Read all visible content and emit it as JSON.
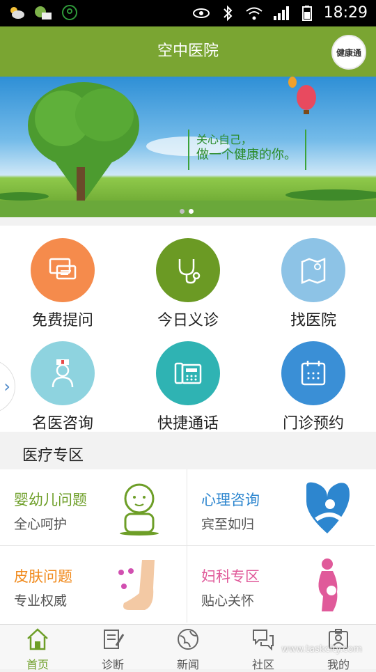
{
  "status_bar": {
    "time": "18:29",
    "icons": [
      "weather-icon",
      "message-icon",
      "app-icon",
      "eye-icon",
      "bluetooth-icon",
      "wifi-icon",
      "signal-icon",
      "battery-icon"
    ]
  },
  "app_bar": {
    "title": "空中医院",
    "badge": "健康通",
    "color": "#7aa532"
  },
  "banner": {
    "line1": "关心自己，",
    "line2": "做一个健康的你。",
    "page_count": 2,
    "active_page": 2
  },
  "grid": {
    "items": [
      {
        "label": "免费提问",
        "color": "#f58b4c",
        "icon": "chat-icon"
      },
      {
        "label": "今日义诊",
        "color": "#6b9a24",
        "icon": "stethoscope-icon"
      },
      {
        "label": "找医院",
        "color": "#8dc3e6",
        "icon": "map-icon"
      },
      {
        "label": "名医咨询",
        "color": "#8ed3df",
        "icon": "doctor-icon"
      },
      {
        "label": "快捷通话",
        "color": "#2fb3b3",
        "icon": "phone-icon"
      },
      {
        "label": "门诊预约",
        "color": "#3a8fd6",
        "icon": "calendar-icon"
      }
    ]
  },
  "section": {
    "title": "医疗专区"
  },
  "cards": [
    {
      "title": "婴幼儿问题",
      "subtitle": "全心呵护",
      "color": "#6d9e27",
      "icon": "baby-icon"
    },
    {
      "title": "心理咨询",
      "subtitle": "宾至如归",
      "color": "#2d86cf",
      "icon": "heart-person-icon"
    },
    {
      "title": "皮肤问题",
      "subtitle": "专业权威",
      "color": "#f08a1c",
      "icon": "foot-icon"
    },
    {
      "title": "妇科专区",
      "subtitle": "贴心关怀",
      "color": "#e05a9a",
      "icon": "pregnant-icon"
    }
  ],
  "tabs": [
    {
      "label": "首页",
      "icon": "home-icon",
      "active": true
    },
    {
      "label": "诊断",
      "icon": "diagnosis-icon",
      "active": false
    },
    {
      "label": "新闻",
      "icon": "globe-icon",
      "active": false
    },
    {
      "label": "社区",
      "icon": "community-icon",
      "active": false
    },
    {
      "label": "我的",
      "icon": "profile-icon",
      "active": false
    }
  ],
  "watermark": "www.taskcity.com"
}
